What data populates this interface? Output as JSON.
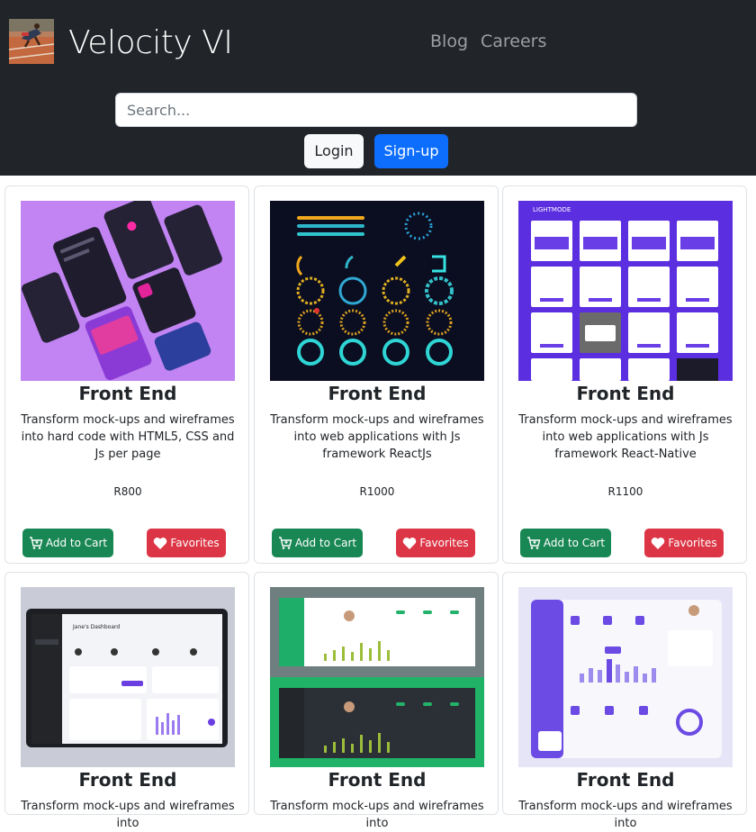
{
  "header": {
    "brand": "Velocity VI",
    "nav": [
      "Blog",
      "Careers"
    ],
    "search_placeholder": "Search...",
    "login_label": "Login",
    "signup_label": "Sign-up"
  },
  "colors": {
    "navbar_bg": "#212529",
    "primary": "#0d6efd",
    "success": "#198754",
    "danger": "#dc3545"
  },
  "cards": [
    {
      "title": "Front End",
      "description": "Transform mock-ups and wireframes into hard code with HTML5, CSS and Js per page",
      "price": "R800",
      "cart_label": "Add to Cart",
      "fav_label": "Favorites",
      "image": "dark-mobile-ui-kit-mockup"
    },
    {
      "title": "Front End",
      "description": "Transform mock-ups and wireframes into web applications with Js framework ReactJs",
      "price": "R1000",
      "cart_label": "Add to Cart",
      "fav_label": "Favorites",
      "image": "circular-loaders-progress-rings"
    },
    {
      "title": "Front End",
      "description": "Transform mock-ups and wireframes into web applications with Js framework React-Native",
      "price": "R1100",
      "cart_label": "Add to Cart",
      "fav_label": "Favorites",
      "image": "purple-lightmode-screens-grid",
      "image_caption": "LIGHTMODE"
    },
    {
      "title": "Front End",
      "description": "Transform mock-ups and wireframes into",
      "image": "laptop-dashboard-mockup",
      "image_caption": "Jane's Dashboard"
    },
    {
      "title": "Front End",
      "description": "Transform mock-ups and wireframes into",
      "image": "green-dashboard-light-dark"
    },
    {
      "title": "Front End",
      "description": "Transform mock-ups and wireframes into",
      "image": "purple-analytics-dashboard"
    }
  ]
}
